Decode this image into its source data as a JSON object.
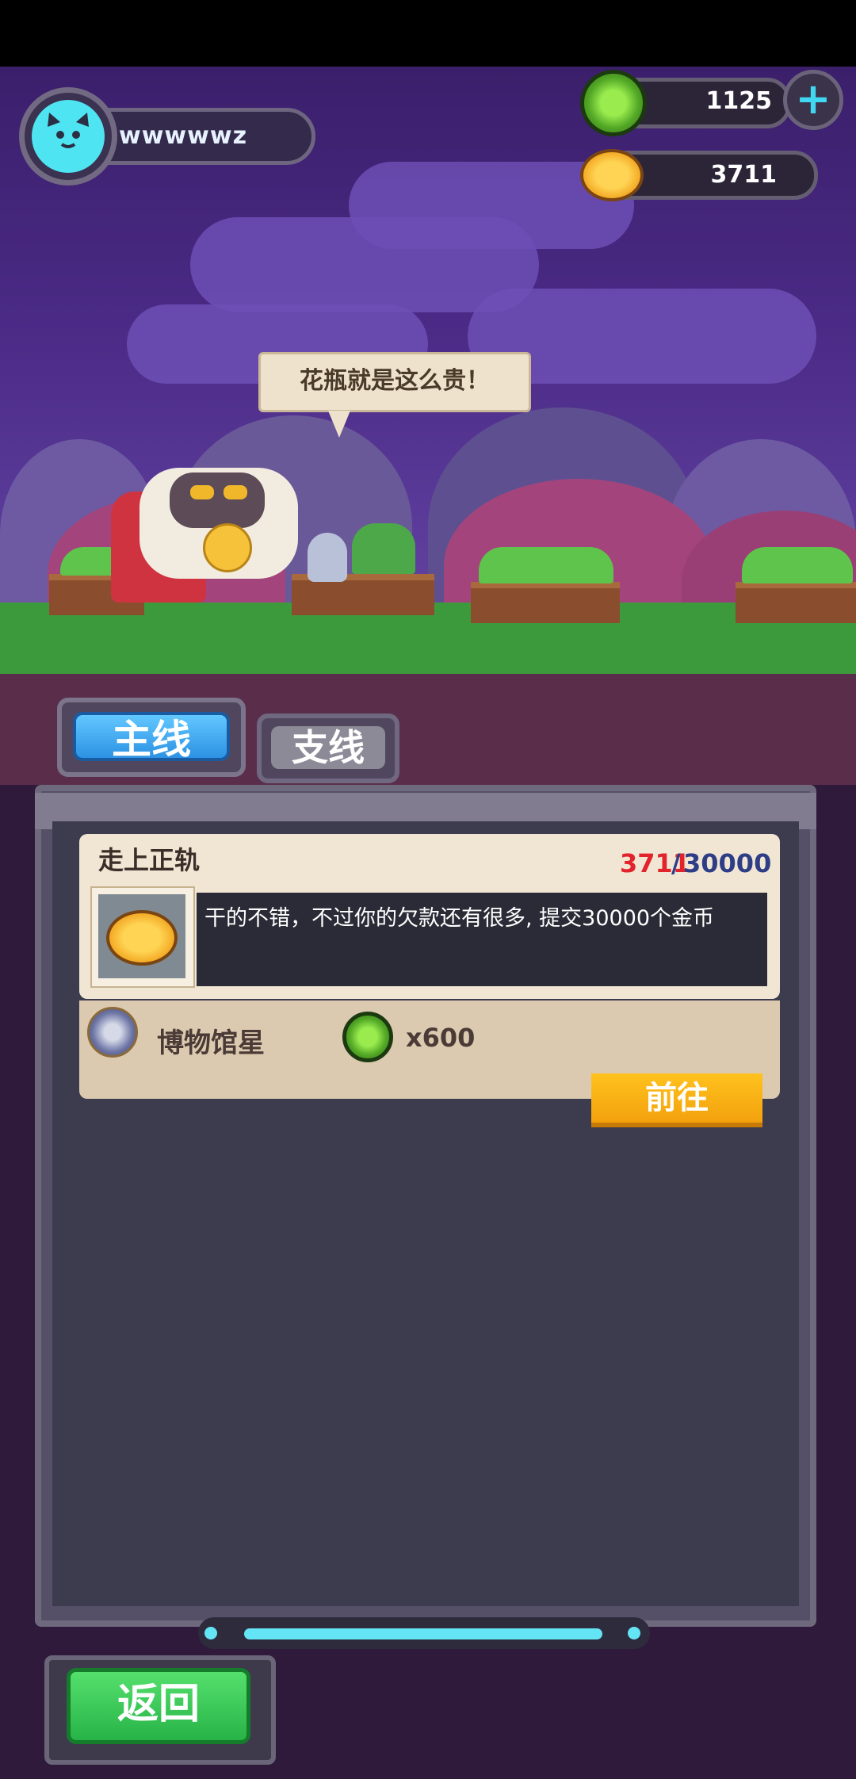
{
  "player": {
    "name": "wwwwwz",
    "avatar_icon": "cat-face-icon"
  },
  "currencies": {
    "gems": {
      "icon": "green-gem-icon",
      "value": "1125"
    },
    "coins": {
      "icon": "gold-coin-icon",
      "value": "3711"
    },
    "add_icon": "plus-icon"
  },
  "npc": {
    "speech": "花瓶就是这么贵！"
  },
  "tabs": [
    {
      "label": "主线",
      "active": true
    },
    {
      "label": "支线",
      "active": false
    }
  ],
  "quest": {
    "title": "走上正轨",
    "progress_current": "3711",
    "progress_separator": "/",
    "progress_target": "30000",
    "description": "干的不错，不过你的欠款还有很多, 提交30000个金币",
    "location_icon": "museum-planet-icon",
    "location": "博物馆星",
    "reward_icon": "green-gem-icon",
    "reward_count": "x600",
    "go_label": "前往"
  },
  "back_label": "返回",
  "colors": {
    "accent_blue": "#3fd8f0",
    "go_orange": "#f7a810",
    "back_green": "#2fbf4f",
    "progress_red": "#e3232b"
  }
}
